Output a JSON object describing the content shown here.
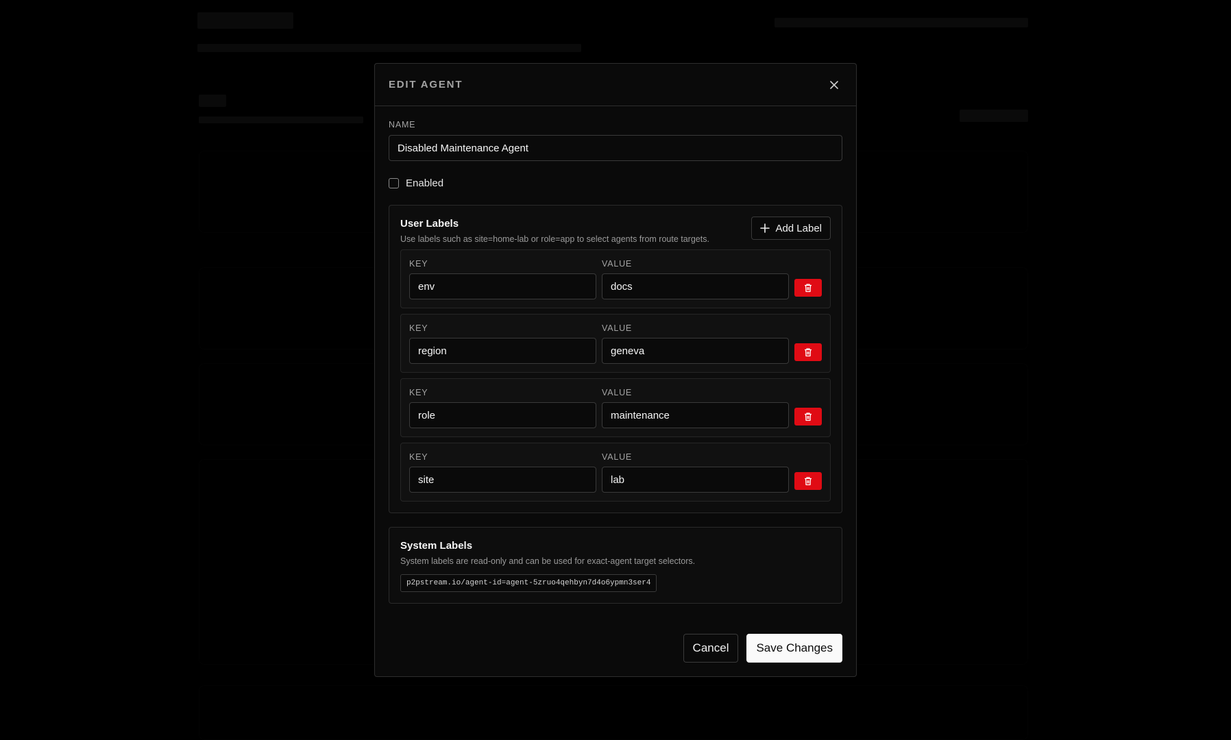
{
  "modal": {
    "title": "EDIT AGENT",
    "close_icon": "close-icon"
  },
  "name_field": {
    "label": "NAME",
    "value": "Disabled Maintenance Agent"
  },
  "enabled": {
    "label": "Enabled",
    "checked": false
  },
  "user_labels": {
    "title": "User Labels",
    "description": "Use labels such as site=home-lab or role=app to select agents from route targets.",
    "add_button": "Add Label",
    "key_label": "KEY",
    "value_label": "VALUE",
    "items": [
      {
        "key": "env",
        "value": "docs"
      },
      {
        "key": "region",
        "value": "geneva"
      },
      {
        "key": "role",
        "value": "maintenance"
      },
      {
        "key": "site",
        "value": "lab"
      }
    ]
  },
  "system_labels": {
    "title": "System Labels",
    "description": "System labels are read-only and can be used for exact-agent target selectors.",
    "chip": "p2pstream.io/agent-id=agent-5zruo4qehbyn7d4o6ypmn3ser4"
  },
  "footer": {
    "cancel": "Cancel",
    "save": "Save Changes"
  },
  "colors": {
    "danger": "#e00b14",
    "primary_button_bg": "#fafafa",
    "background": "#000000"
  }
}
